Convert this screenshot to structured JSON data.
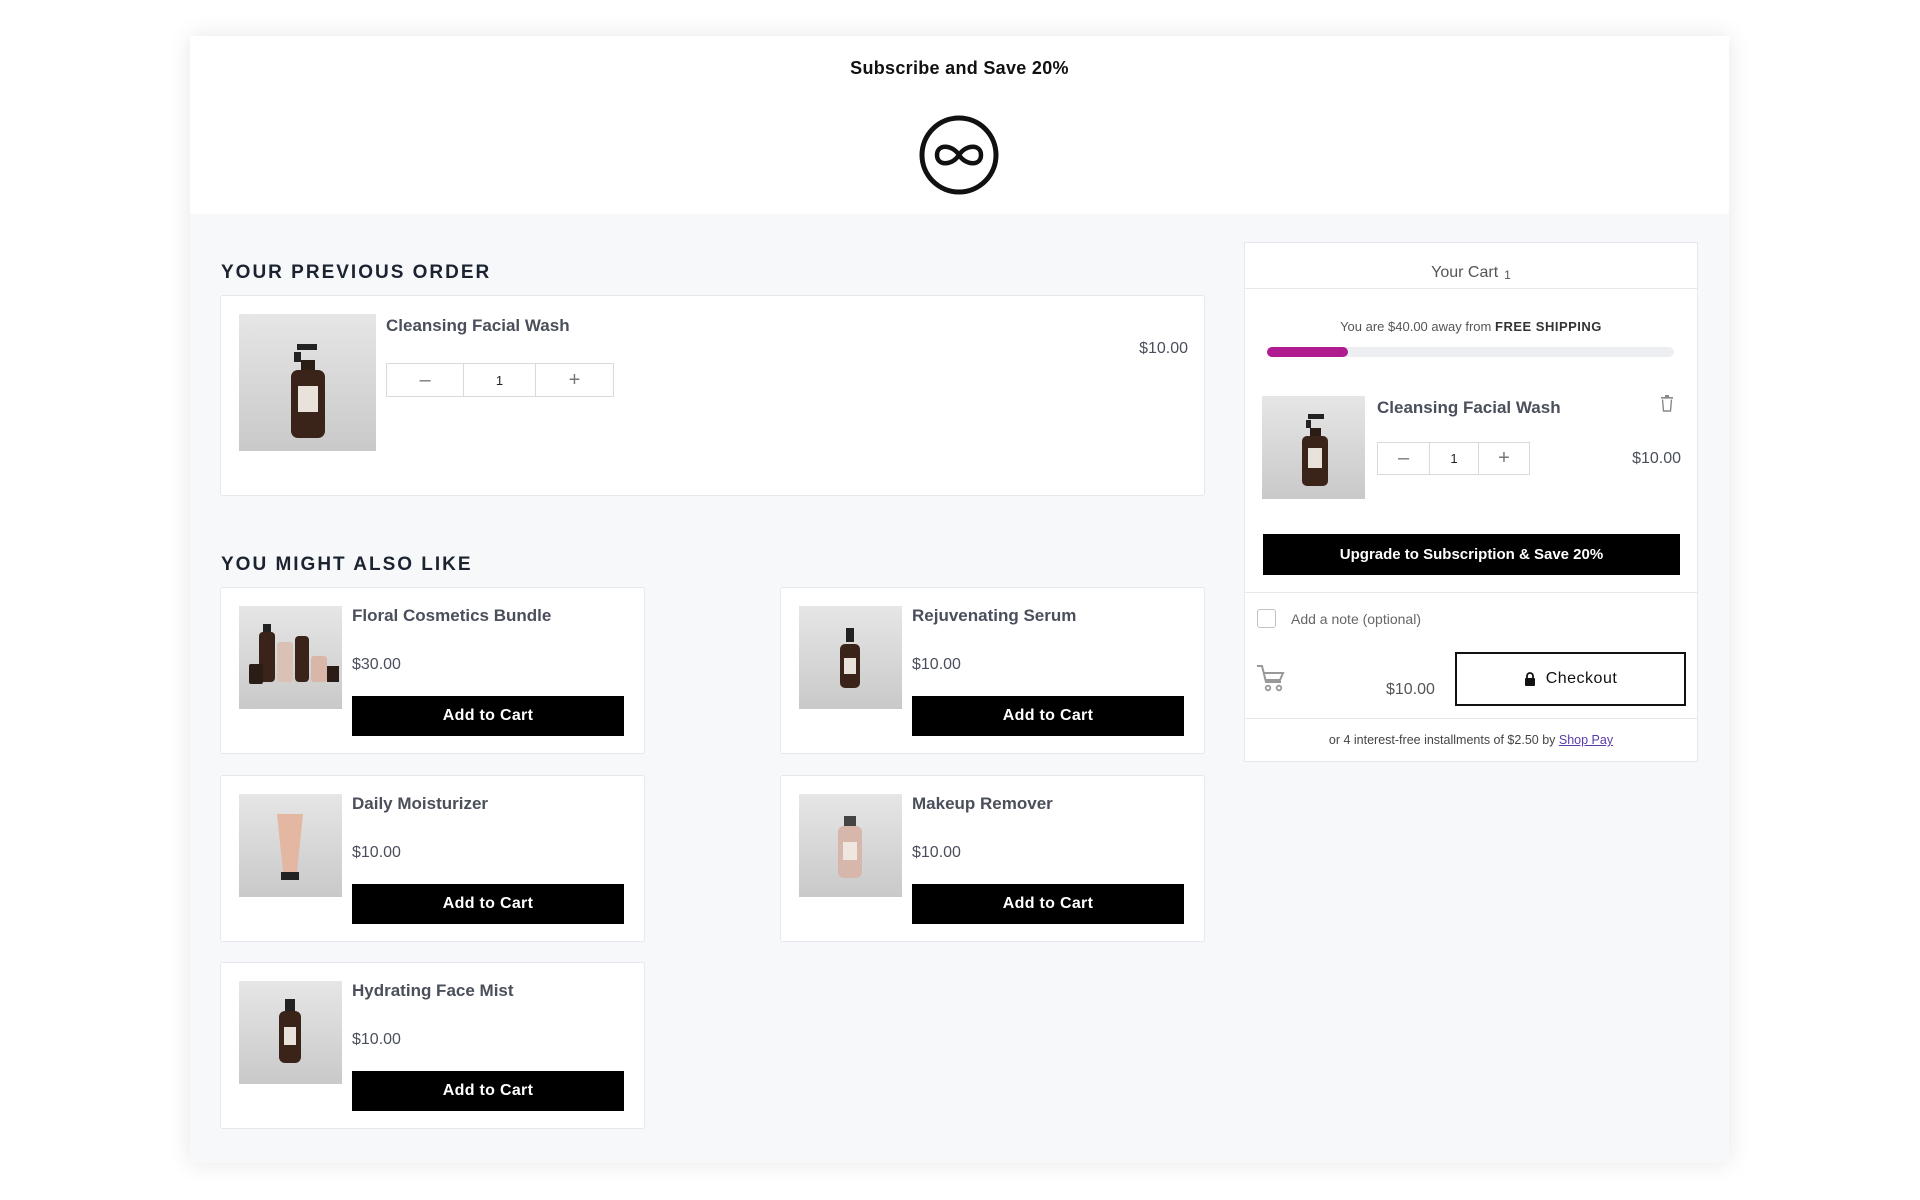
{
  "header": {
    "title": "Subscribe and Save 20%",
    "logo_icon": "infinity-circle-icon"
  },
  "previous_order": {
    "section_title": "YOUR PREVIOUS ORDER",
    "item": {
      "name": "Cleansing Facial Wash",
      "qty": "1",
      "price": "$10.00"
    }
  },
  "recommendations": {
    "section_title": "YOU MIGHT ALSO LIKE",
    "button_label": "Add to Cart",
    "items": [
      {
        "name": "Floral Cosmetics Bundle",
        "price": "$30.00"
      },
      {
        "name": "Rejuvenating Serum",
        "price": "$10.00"
      },
      {
        "name": "Daily Moisturizer",
        "price": "$10.00"
      },
      {
        "name": "Makeup Remover",
        "price": "$10.00"
      },
      {
        "name": "Hydrating Face Mist",
        "price": "$10.00"
      }
    ]
  },
  "cart": {
    "title": "Your Cart",
    "count": "1",
    "shipping_prefix": "You are $40.00 away from",
    "shipping_target": "FREE SHIPPING",
    "shipping_progress": 0.2,
    "progress_color": "#b01c8f",
    "item": {
      "name": "Cleansing Facial Wash",
      "qty": "1",
      "price": "$10.00"
    },
    "upgrade_label": "Upgrade to Subscription & Save 20%",
    "note_label": "Add a note (optional)",
    "subtotal": "$10.00",
    "checkout_label": "Checkout",
    "installments_text": "or 4 interest-free installments of $2.50 by",
    "installments_link": "Shop Pay"
  }
}
